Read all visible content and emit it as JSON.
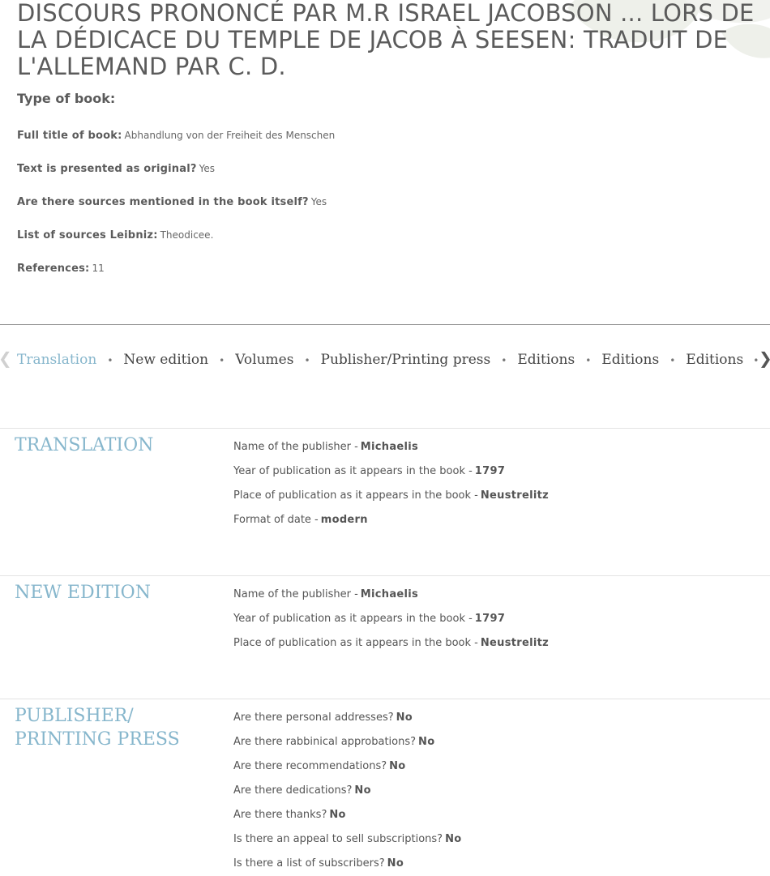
{
  "book": {
    "title": "DISCOURS PRONONCÉ PAR M.R ISRAEL JACOBSON ... LORS DE LA DÉDICACE DU TEMPLE DE JACOB À SEESEN: TRADUIT DE L'ALLEMAND PAR C. D.",
    "type_label": "Type of book:",
    "fields": [
      {
        "label": "Full title of book:",
        "value": "Abhandlung von der Freiheit des Menschen"
      },
      {
        "label": "Text is presented as original?",
        "value": "Yes"
      },
      {
        "label": "Are there sources mentioned in the book itself?",
        "value": "Yes"
      },
      {
        "label": "List of sources Leibniz:",
        "value": "Theodicee."
      },
      {
        "label": "References:",
        "value": "11"
      }
    ]
  },
  "tabs": {
    "items": [
      "Translation",
      "New edition",
      "Volumes",
      "Publisher/Printing press",
      "Editions",
      "Editions",
      "Editions"
    ],
    "active_index": 0,
    "overflow": "…",
    "prev_icon": "chevron-left-icon",
    "next_icon": "chevron-right-icon"
  },
  "sections": {
    "translation": {
      "title": "TRANSLATION",
      "rows": [
        {
          "label": "Name of the publisher -",
          "value": "Michaelis"
        },
        {
          "label": "Year of publication as it appears in the book -",
          "value": "1797"
        },
        {
          "label": "Place of publication as it appears in the book -",
          "value": "Neustrelitz"
        },
        {
          "label": "Format of date -",
          "value": "modern"
        }
      ]
    },
    "new_edition": {
      "title": "NEW EDITION",
      "rows": [
        {
          "label": "Name of the publisher -",
          "value": "Michaelis"
        },
        {
          "label": "Year of publication as it appears in the book -",
          "value": "1797"
        },
        {
          "label": "Place of publication as it appears in the book -",
          "value": "Neustrelitz"
        }
      ]
    },
    "publisher": {
      "title": "PUBLISHER/ PRINTING PRESS",
      "rows": [
        {
          "label": "Are there personal addresses?",
          "value": "No"
        },
        {
          "label": "Are there rabbinical approbations?",
          "value": "No"
        },
        {
          "label": "Are there recommendations?",
          "value": "No"
        },
        {
          "label": "Are there dedications?",
          "value": "No"
        },
        {
          "label": "Are there thanks?",
          "value": "No"
        },
        {
          "label": "Is there an appeal to sell subscriptions?",
          "value": "No"
        },
        {
          "label": "Is there a list of subscribers?",
          "value": "No"
        }
      ]
    }
  },
  "colors": {
    "accent": "#86b6cc",
    "text": "#5b5b5b",
    "rule": "#999999"
  }
}
